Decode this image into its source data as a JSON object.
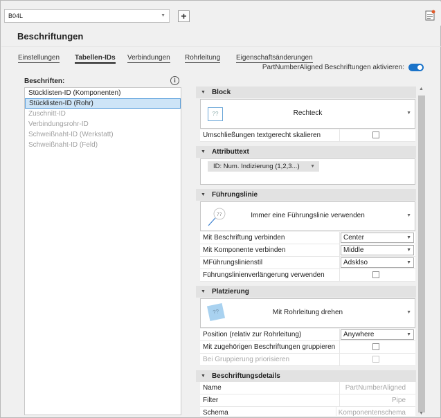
{
  "top": {
    "combo_value": "B04L"
  },
  "page_title": "Beschriftungen",
  "tabs": [
    {
      "label": "Einstellungen",
      "active": false
    },
    {
      "label": "Tabellen-IDs",
      "active": true
    },
    {
      "label": "Verbindungen",
      "active": false
    },
    {
      "label": "Rohrleitung",
      "active": false
    },
    {
      "label": "Eigenschaftsänderungen",
      "active": false
    }
  ],
  "toggle": {
    "label": "PartNumberAligned Beschriftungen aktivieren:",
    "on": true
  },
  "left": {
    "label": "Beschriften:",
    "items": [
      {
        "label": "Stücklisten-ID (Komponenten)",
        "state": "normal"
      },
      {
        "label": "Stücklisten-ID (Rohr)",
        "state": "selected"
      },
      {
        "label": "Zuschnitt-ID",
        "state": "disabled"
      },
      {
        "label": "Verbindungsrohr-ID",
        "state": "disabled"
      },
      {
        "label": "Schweißnaht-ID (Werkstatt)",
        "state": "disabled"
      },
      {
        "label": "Schweißnaht-ID (Feld)",
        "state": "disabled"
      }
    ]
  },
  "sections": {
    "block": {
      "title": "Block",
      "style": "Rechteck",
      "icon_text": "??",
      "scale_label": "Umschließungen textgerecht skalieren"
    },
    "attribute": {
      "title": "Attributtext",
      "tag": "ID: Num. Indizierung (1,2,3...)"
    },
    "leader": {
      "title": "Führungslinie",
      "style": "Immer eine Führungslinie verwenden",
      "icon_text": "??",
      "rows": [
        {
          "label": "Mit Beschriftung verbinden",
          "value": "Center"
        },
        {
          "label": "Mit Komponente verbinden",
          "value": "Middle"
        },
        {
          "label": "MFührungslinienstil",
          "value": "Adsklso"
        }
      ],
      "extension_label": "Führungslinienverlängerung verwenden"
    },
    "placement": {
      "title": "Platzierung",
      "style": "Mit Rohrleitung drehen",
      "icon_text": "??",
      "position_label": "Position (relativ zur Rohrleitung)",
      "position_value": "Anywhere",
      "group_label": "Mit zugehörigen Beschriftungen gruppieren",
      "prioritize_label": "Bei Gruppierung priorisieren"
    },
    "details": {
      "title": "Beschriftungsdetails",
      "rows": [
        {
          "label": "Name",
          "value": "PartNumberAligned"
        },
        {
          "label": "Filter",
          "value": "Pipe"
        },
        {
          "label": "Schema",
          "value": "Komponentenschema"
        }
      ]
    }
  },
  "colors": {
    "accent": "#1a73c9",
    "selection": "#cde4f7",
    "header": "#e2e2e2"
  }
}
